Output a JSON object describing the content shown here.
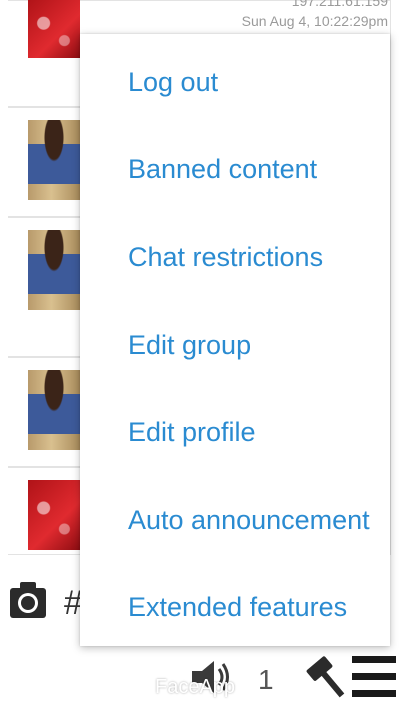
{
  "header": {
    "ip_partial": "197.211.61.159",
    "timestamp": "Sun Aug 4, 10:22:29pm"
  },
  "popup_menu": {
    "items": [
      {
        "label": "Log out"
      },
      {
        "label": "Banned content"
      },
      {
        "label": "Chat restrictions"
      },
      {
        "label": "Edit group"
      },
      {
        "label": "Edit profile"
      },
      {
        "label": "Auto announcement"
      },
      {
        "label": "Extended features"
      }
    ]
  },
  "toolbar": {
    "hash": "#",
    "count": "1",
    "icons": [
      "camera-icon",
      "speaker-icon",
      "gavel-icon",
      "menu-icon"
    ]
  },
  "watermark": "FaceApp",
  "colors": {
    "menu_text": "#2a8bd1",
    "accent_red": "#d8202a"
  }
}
